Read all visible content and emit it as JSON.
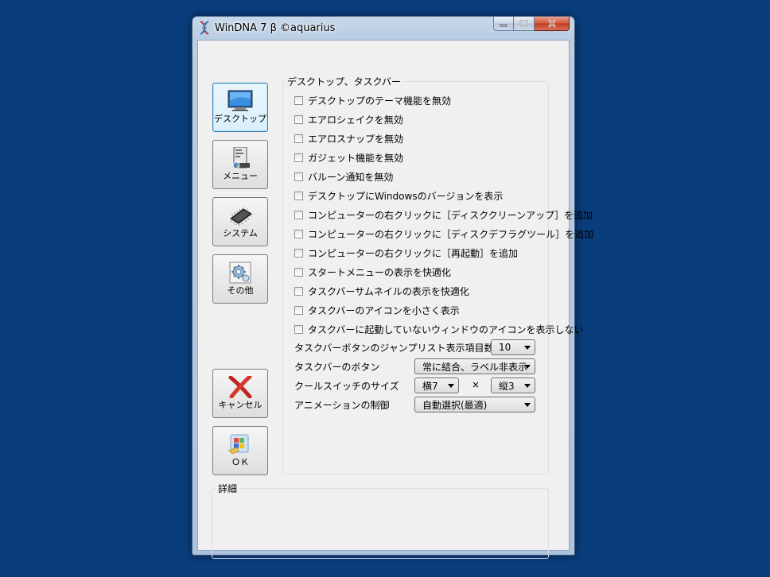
{
  "window": {
    "title": "WinDNA 7 β ©aquarius"
  },
  "nav": [
    {
      "label": "デスクトップ",
      "icon": "monitor-icon",
      "active": true
    },
    {
      "label": "メニュー",
      "icon": "start-menu-icon",
      "active": false
    },
    {
      "label": "システム",
      "icon": "chip-icon",
      "active": false
    },
    {
      "label": "その他",
      "icon": "gear-icon",
      "active": false
    },
    {
      "label": "キャンセル",
      "icon": "cancel-x-icon",
      "active": false
    },
    {
      "label": "ＯＫ",
      "icon": "ok-flag-icon",
      "active": false
    }
  ],
  "group": {
    "title": "デスクトップ、タスクバー",
    "checks": [
      {
        "label": "デスクトップのテーマ機能を無効",
        "checked": false
      },
      {
        "label": "エアロシェイクを無効",
        "checked": false
      },
      {
        "label": "エアロスナップを無効",
        "checked": false
      },
      {
        "label": "ガジェット機能を無効",
        "checked": false
      },
      {
        "label": "バルーン通知を無効",
        "checked": false
      },
      {
        "label": "デスクトップにWindowsのバージョンを表示",
        "checked": false
      },
      {
        "label": "コンピューターの右クリックに［ディスククリーンアップ］を追加",
        "checked": false
      },
      {
        "label": "コンピューターの右クリックに［ディスクデフラグツール］を追加",
        "checked": false
      },
      {
        "label": "コンピューターの右クリックに［再起動］を追加",
        "checked": false
      },
      {
        "label": "スタートメニューの表示を快適化",
        "checked": false
      },
      {
        "label": "タスクバーサムネイルの表示を快適化",
        "checked": false
      },
      {
        "label": "タスクバーのアイコンを小さく表示",
        "checked": false
      },
      {
        "label": "タスクバーに起動していないウィンドウのアイコンを表示しない",
        "checked": false
      }
    ],
    "options": {
      "jumplist": {
        "label": "タスクバーボタンのジャンプリスト表示項目数",
        "value": "10"
      },
      "taskbar_buttons": {
        "label": "タスクバーのボタン",
        "value": "常に結合、ラベル非表示"
      },
      "coolswitch": {
        "label": "クールスイッチのサイズ",
        "width_value": "横7",
        "times": "×",
        "height_value": "縦3"
      },
      "animation": {
        "label": "アニメーションの制御",
        "value": "自動選択(最適)"
      }
    }
  },
  "details": {
    "title": "詳細"
  },
  "colors": {
    "desktop": "#093d7c",
    "close_button": "#c13d21",
    "active_nav_border": "#3c7fb1"
  }
}
